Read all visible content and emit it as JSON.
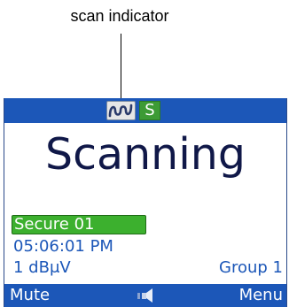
{
  "callout": {
    "label": "scan indicator"
  },
  "status_bar": {
    "scan_icon": "scan-wave-icon",
    "secure_icon": "secure-s-icon",
    "secure_letter": "S"
  },
  "main": {
    "status": "Scanning",
    "channel": "Secure 01",
    "time": "05:06:01 PM",
    "rf_level": "1 dBμV",
    "group": "Group 1"
  },
  "softkeys": {
    "left": "Mute",
    "center_icon": "speaker-icon",
    "right": "Menu"
  },
  "colors": {
    "bar_blue": "#1c57b8",
    "channel_green": "#3cb02e",
    "secure_green": "#3d9b35",
    "title_navy": "#101848"
  }
}
